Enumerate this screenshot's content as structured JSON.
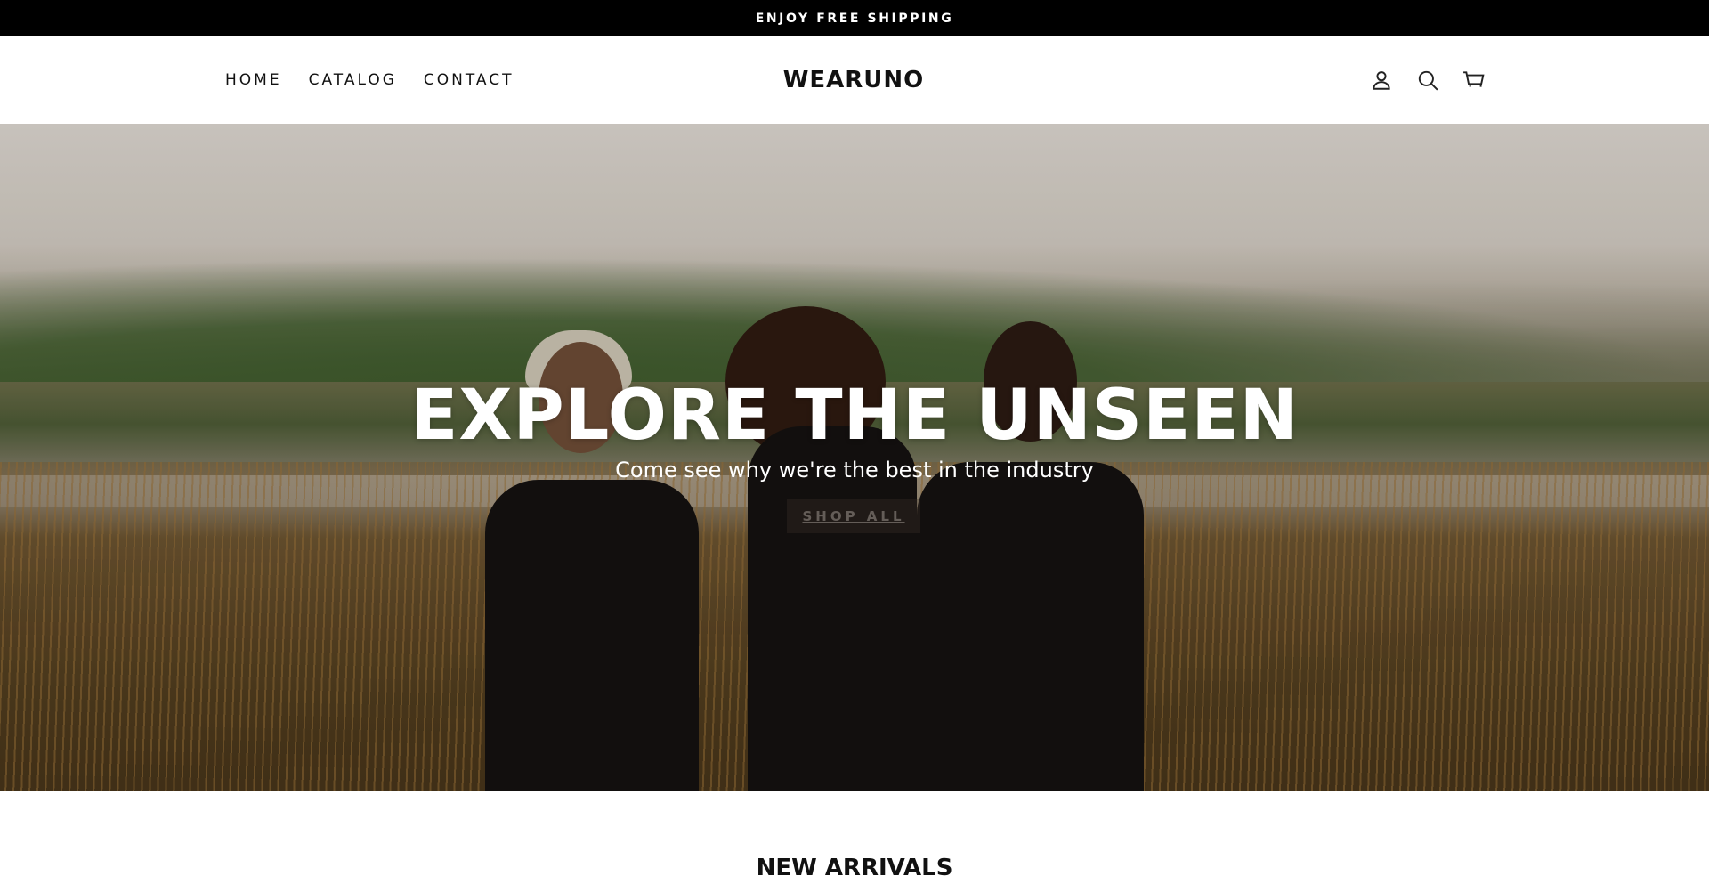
{
  "announcement": {
    "text": "ENJOY FREE SHIPPING"
  },
  "header": {
    "nav": [
      {
        "label": "HOME"
      },
      {
        "label": "CATALOG"
      },
      {
        "label": "CONTACT"
      }
    ],
    "logo": "WEARUNO",
    "icons": [
      "account-icon",
      "search-icon",
      "cart-icon"
    ]
  },
  "hero": {
    "title": "EXPLORE THE UNSEEN",
    "subtitle": "Come see why we're the best in the industry",
    "button_label": "SHOP ALL"
  },
  "section": {
    "title": "NEW ARRIVALS"
  }
}
